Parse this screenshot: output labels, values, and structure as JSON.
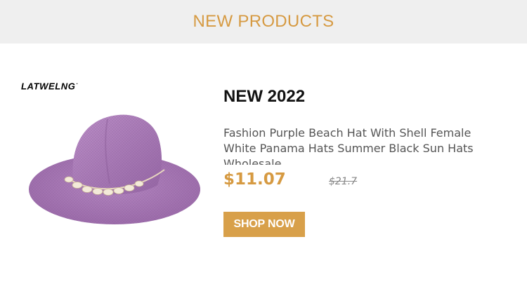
{
  "header": {
    "title": "NEW PRODUCTS"
  },
  "brand": {
    "logo_text": "LATWELNG",
    "logo_mark": "·"
  },
  "product": {
    "image_icon": "purple-fedora-hat-with-shell-band",
    "title": "NEW 2022",
    "description": "Fashion Purple Beach Hat With Shell Female White Panama Hats Summer Black Sun Hats Wholesale",
    "price": "$11.07",
    "original_price": "$21.7",
    "button_label": "SHOP NOW"
  },
  "colors": {
    "accent": "#d69a42",
    "header_bg": "#efefef",
    "button_bg": "#d8a04a",
    "hat": "#a77ab4"
  }
}
